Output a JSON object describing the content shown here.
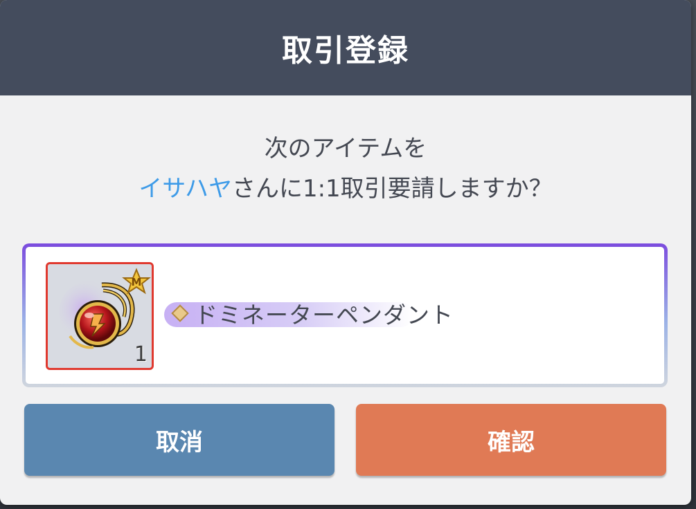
{
  "dialog": {
    "title": "取引登録",
    "message_line1": "次のアイテムを",
    "player_name": "イサハヤ",
    "message_line2_rest": "さんに1:1取引要請しますか？"
  },
  "item": {
    "name": "ドミネーターペンダント",
    "quantity": "1",
    "badge": "M",
    "icon": "pendant-icon"
  },
  "buttons": {
    "cancel_label": "取消",
    "confirm_label": "確認"
  },
  "colors": {
    "header": "#444c5d",
    "player_name": "#3e9be8",
    "cancel": "#5a87b0",
    "confirm": "#e07a55",
    "slot_border": "#e0392f"
  }
}
